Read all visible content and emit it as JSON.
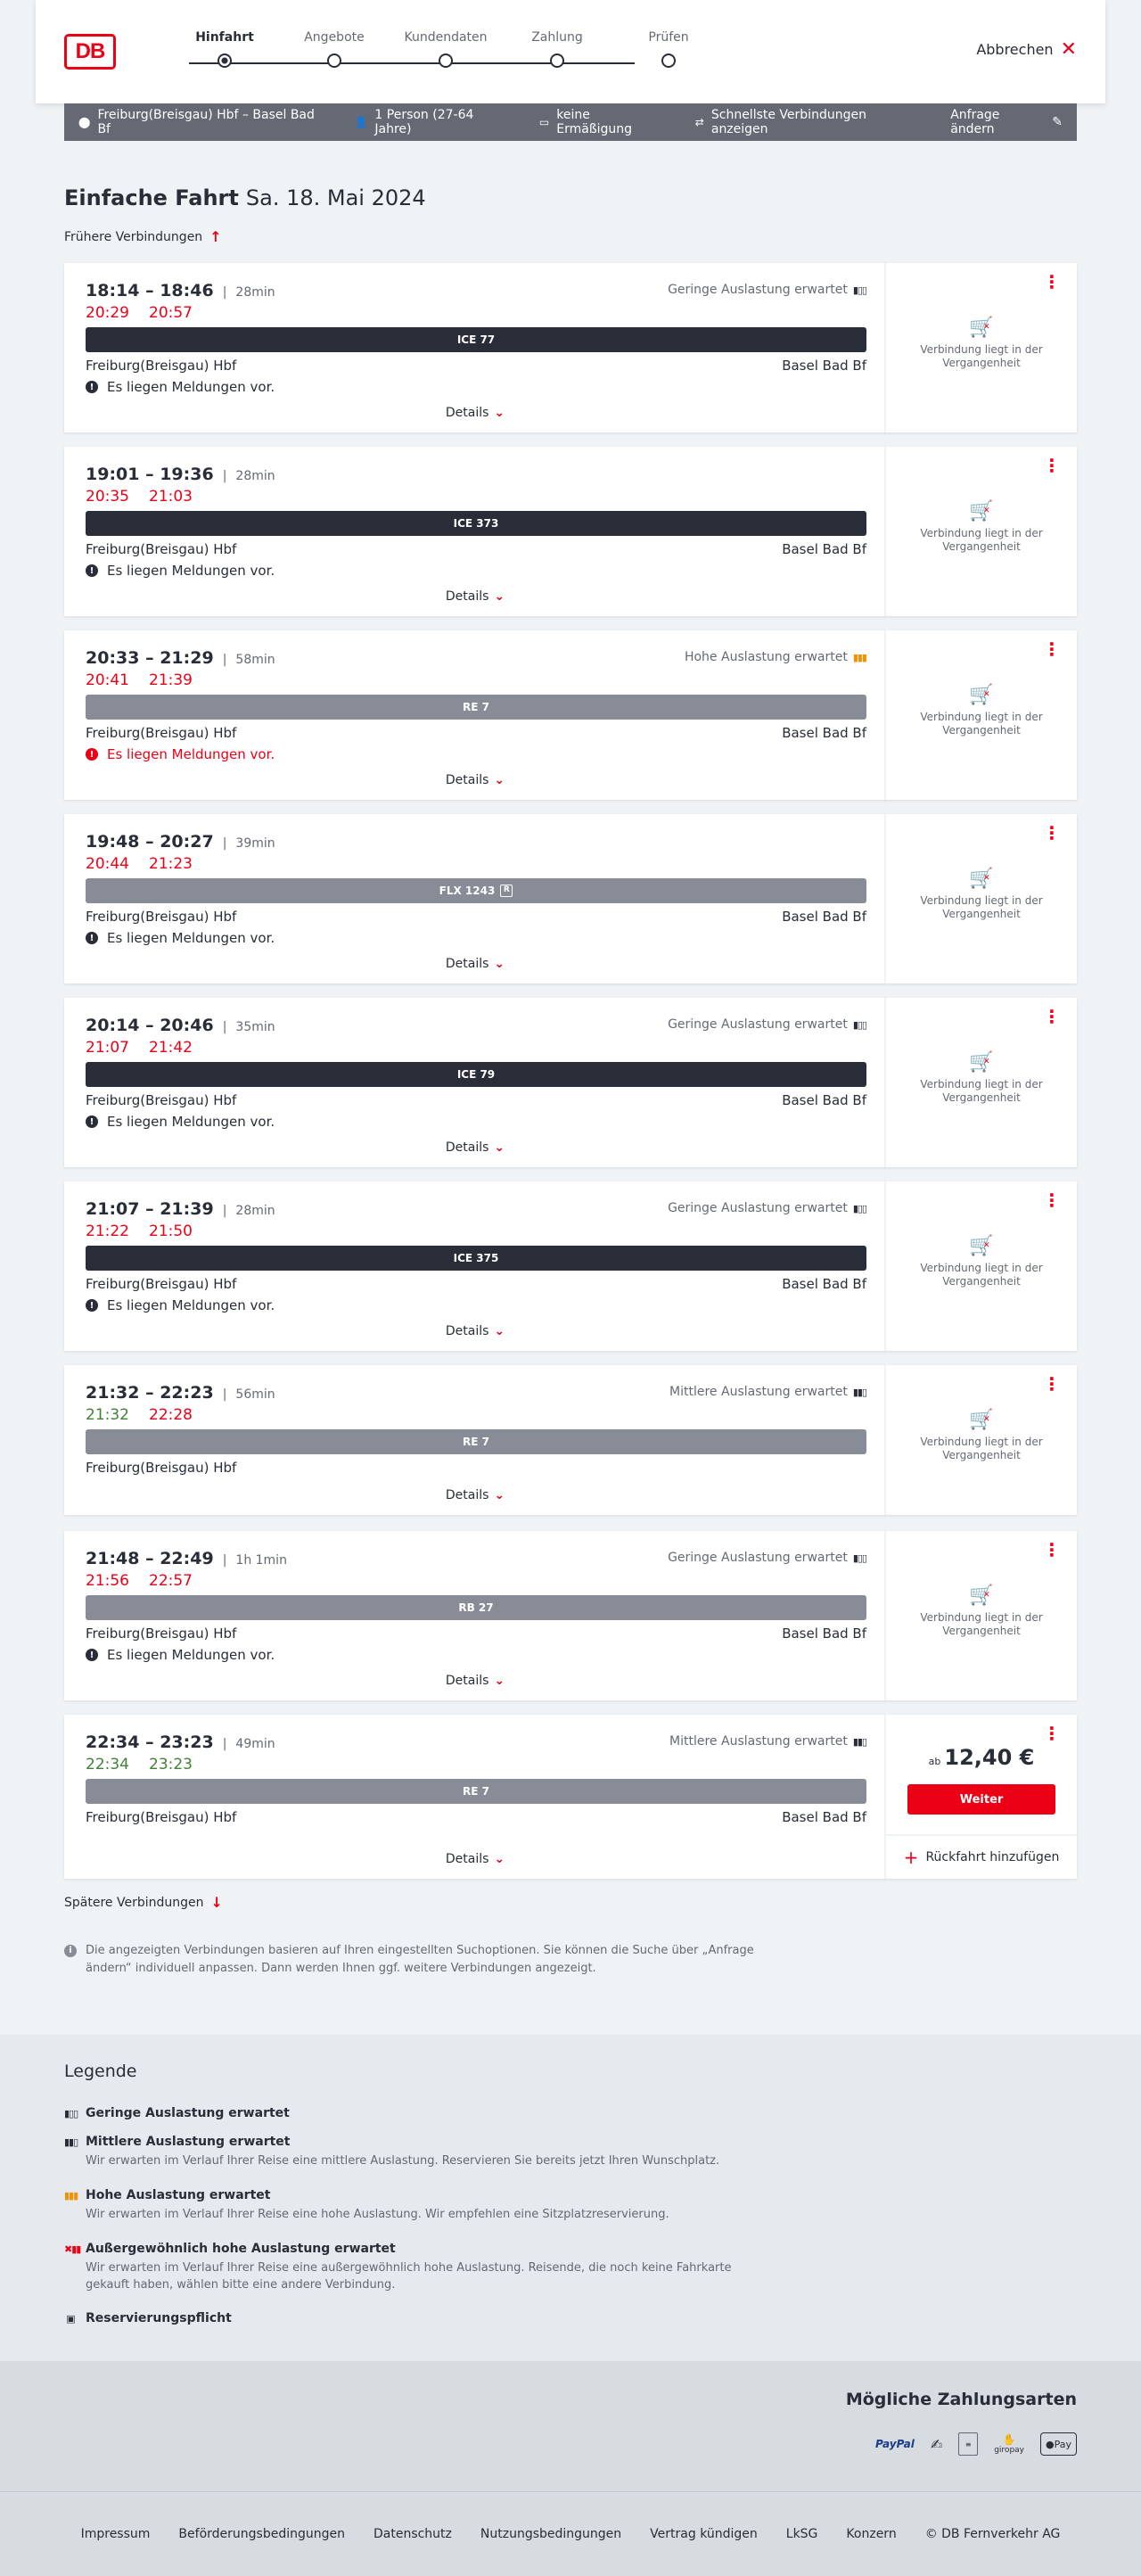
{
  "header": {
    "logo": "DB",
    "steps": [
      "Hinfahrt",
      "Angebote",
      "Kundendaten",
      "Zahlung",
      "Prüfen"
    ],
    "cancel": "Abbrechen"
  },
  "summary": {
    "route": "Freiburg(Breisgau) Hbf – Basel Bad Bf",
    "persons": "1 Person (27-64 Jahre)",
    "discount": "keine Ermäßigung",
    "fastest": "Schnellste Verbindungen anzeigen",
    "edit": "Anfrage ändern"
  },
  "page": {
    "title": "Einfache Fahrt",
    "date": "Sa. 18. Mai 2024",
    "earlier": "Frühere Verbindungen",
    "later": "Spätere Verbindungen",
    "note": "Die angezeigten Verbindungen basieren auf Ihren eingestellten Suchoptionen. Sie können die Suche über „Anfrage ändern“ individuell anpassen. Dann werden Ihnen ggf. weitere Verbindungen angezeigt."
  },
  "common": {
    "from": "Freiburg(Breisgau) Hbf",
    "to": "Basel Bad Bf",
    "details": "Details",
    "message": "Es liegen Meldungen vor.",
    "past": "Verbindung liegt in der Vergangenheit",
    "price_prefix": "ab",
    "continue": "Weiter",
    "return_trip": "Rückfahrt hinzufügen"
  },
  "connections": [
    {
      "times": "18:14 – 18:46",
      "duration": "28min",
      "rt_dep": "20:29",
      "rt_arr": "20:57",
      "rt_color": "red",
      "occupancy": "Geringe Auslastung erwartet",
      "occ_icon": "low",
      "train": "ICE 77",
      "train_style": "dark",
      "show_to": true,
      "message": true,
      "alert": false,
      "state": "past"
    },
    {
      "times": "19:01 – 19:36",
      "duration": "28min",
      "rt_dep": "20:35",
      "rt_arr": "21:03",
      "rt_color": "red",
      "occupancy": "",
      "occ_icon": "",
      "train": "ICE 373",
      "train_style": "dark",
      "show_to": true,
      "message": true,
      "alert": false,
      "state": "past"
    },
    {
      "times": "20:33 – 21:29",
      "duration": "58min",
      "rt_dep": "20:41",
      "rt_arr": "21:39",
      "rt_color": "red",
      "occupancy": "Hohe Auslastung erwartet",
      "occ_icon": "high",
      "train": "RE 7",
      "train_style": "grey",
      "show_to": true,
      "message": true,
      "alert": true,
      "state": "past"
    },
    {
      "times": "19:48 – 20:27",
      "duration": "39min",
      "rt_dep": "20:44",
      "rt_arr": "21:23",
      "rt_color": "red",
      "occupancy": "",
      "occ_icon": "",
      "train": "FLX 1243",
      "train_style": "grey",
      "reservation": true,
      "show_to": true,
      "message": true,
      "alert": false,
      "state": "past"
    },
    {
      "times": "20:14 – 20:46",
      "duration": "35min",
      "rt_dep": "21:07",
      "rt_arr": "21:42",
      "rt_color": "red",
      "occupancy": "Geringe Auslastung erwartet",
      "occ_icon": "low",
      "train": "ICE 79",
      "train_style": "dark",
      "show_to": true,
      "message": true,
      "alert": false,
      "state": "past"
    },
    {
      "times": "21:07 – 21:39",
      "duration": "28min",
      "rt_dep": "21:22",
      "rt_arr": "21:50",
      "rt_color": "red",
      "occupancy": "Geringe Auslastung erwartet",
      "occ_icon": "low",
      "train": "ICE 375",
      "train_style": "dark",
      "show_to": true,
      "message": true,
      "alert": false,
      "state": "past"
    },
    {
      "times": "21:32 – 22:23",
      "duration": "56min",
      "rt_dep": "21:32",
      "rt_arr": "22:28",
      "rt_color": "mixed",
      "occupancy": "Mittlere Auslastung erwartet",
      "occ_icon": "mid",
      "train": "RE 7",
      "train_style": "grey",
      "show_to": false,
      "message": false,
      "alert": false,
      "state": "past"
    },
    {
      "times": "21:48 – 22:49",
      "duration": "1h 1min",
      "rt_dep": "21:56",
      "rt_arr": "22:57",
      "rt_color": "red",
      "occupancy": "Geringe Auslastung erwartet",
      "occ_icon": "low",
      "train": "RB 27",
      "train_style": "grey",
      "show_to": true,
      "message": true,
      "alert": false,
      "state": "past"
    },
    {
      "times": "22:34 – 23:23",
      "duration": "49min",
      "rt_dep": "22:34",
      "rt_arr": "23:23",
      "rt_color": "green",
      "occupancy": "Mittlere Auslastung erwartet",
      "occ_icon": "mid",
      "train": "RE 7",
      "train_style": "grey",
      "show_to": true,
      "message": false,
      "alert": false,
      "state": "bookable",
      "price": "12,40 €"
    }
  ],
  "legend": {
    "title": "Legende",
    "items": [
      {
        "title": "Geringe Auslastung erwartet",
        "desc": "",
        "icon": "low"
      },
      {
        "title": "Mittlere Auslastung erwartet",
        "desc": "Wir erwarten im Verlauf Ihrer Reise eine mittlere Auslastung. Reservieren Sie bereits jetzt Ihren Wunschplatz.",
        "icon": "mid"
      },
      {
        "title": "Hohe Auslastung erwartet",
        "desc": "Wir erwarten im Verlauf Ihrer Reise eine hohe Auslastung. Wir empfehlen eine Sitzplatzreservierung.",
        "icon": "high"
      },
      {
        "title": "Außergewöhnlich hohe Auslastung erwartet",
        "desc": "Wir erwarten im Verlauf Ihrer Reise eine außergewöhnlich hohe Auslastung. Reisende, die noch keine Fahrkarte gekauft haben, wählen bitte eine andere Verbindung.",
        "icon": "extreme"
      },
      {
        "title": "Reservierungspflicht",
        "desc": "",
        "icon": "reservation"
      }
    ]
  },
  "payment": {
    "title": "Mögliche Zahlungsarten",
    "logos": [
      "PayPal",
      "giropay",
      "Pay"
    ]
  },
  "footer": {
    "links": [
      "Impressum",
      "Beförderungsbedingungen",
      "Datenschutz",
      "Nutzungsbedingungen",
      "Vertrag kündigen",
      "LkSG",
      "Konzern",
      "© DB Fernverkehr AG"
    ]
  },
  "colors": {
    "brand_red": "#ec0016",
    "dark": "#282d37",
    "grey_train": "#878c96",
    "green": "#408335",
    "orange": "#f39200"
  }
}
